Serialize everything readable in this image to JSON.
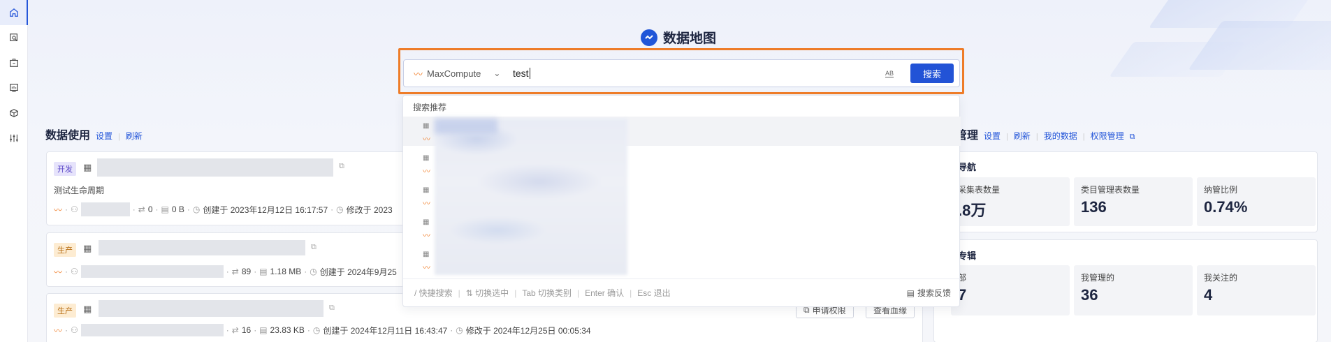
{
  "page": {
    "title": "数据地图"
  },
  "rail": {
    "items": [
      "home",
      "data-search",
      "data-package",
      "dashboard",
      "cube",
      "settings-sliders"
    ]
  },
  "search": {
    "source": "MaxCompute",
    "query": "test",
    "case_label": "AB",
    "button": "搜索",
    "suggest_header": "搜索推荐",
    "footer": {
      "hints": [
        "/ 快捷搜索",
        "⇅ 切换选中",
        "Tab 切换类别",
        "Enter 确认",
        "Esc 退出"
      ],
      "feedback": "搜索反馈"
    }
  },
  "usage": {
    "title": "数据使用",
    "settings": "设置",
    "refresh": "刷新",
    "cards": [
      {
        "tag": "开发",
        "desc": "测试生命周期",
        "lineage": "0",
        "size": "0 B",
        "created": "创建于 2023年12月12日 16:17:57",
        "modified": "修改于 2023"
      },
      {
        "tag": "生产",
        "lineage": "89",
        "size": "1.18 MB",
        "created": "创建于 2024年9月25"
      },
      {
        "tag": "生产",
        "lineage": "16",
        "size": "23.83 KB",
        "created": "创建于 2024年12月11日 16:43:47",
        "modified": "修改于 2024年12月25日 00:05:34",
        "apply": "申请权限",
        "view": "查看血缘"
      }
    ]
  },
  "manage": {
    "title": "管理",
    "links": [
      "设置",
      "刷新",
      "我的数据",
      "权限管理"
    ],
    "nav_title": "导航",
    "stats": [
      {
        "label": "采集表数量",
        "value": ".8万"
      },
      {
        "label": "类目管理表数量",
        "value": "136"
      },
      {
        "label": "纳管比例",
        "value": "0.74%"
      }
    ],
    "album_title": "专辑",
    "albums": [
      {
        "label": "部",
        "value": "7"
      },
      {
        "label": "我管理的",
        "value": "36"
      },
      {
        "label": "我关注的",
        "value": "4"
      }
    ]
  }
}
